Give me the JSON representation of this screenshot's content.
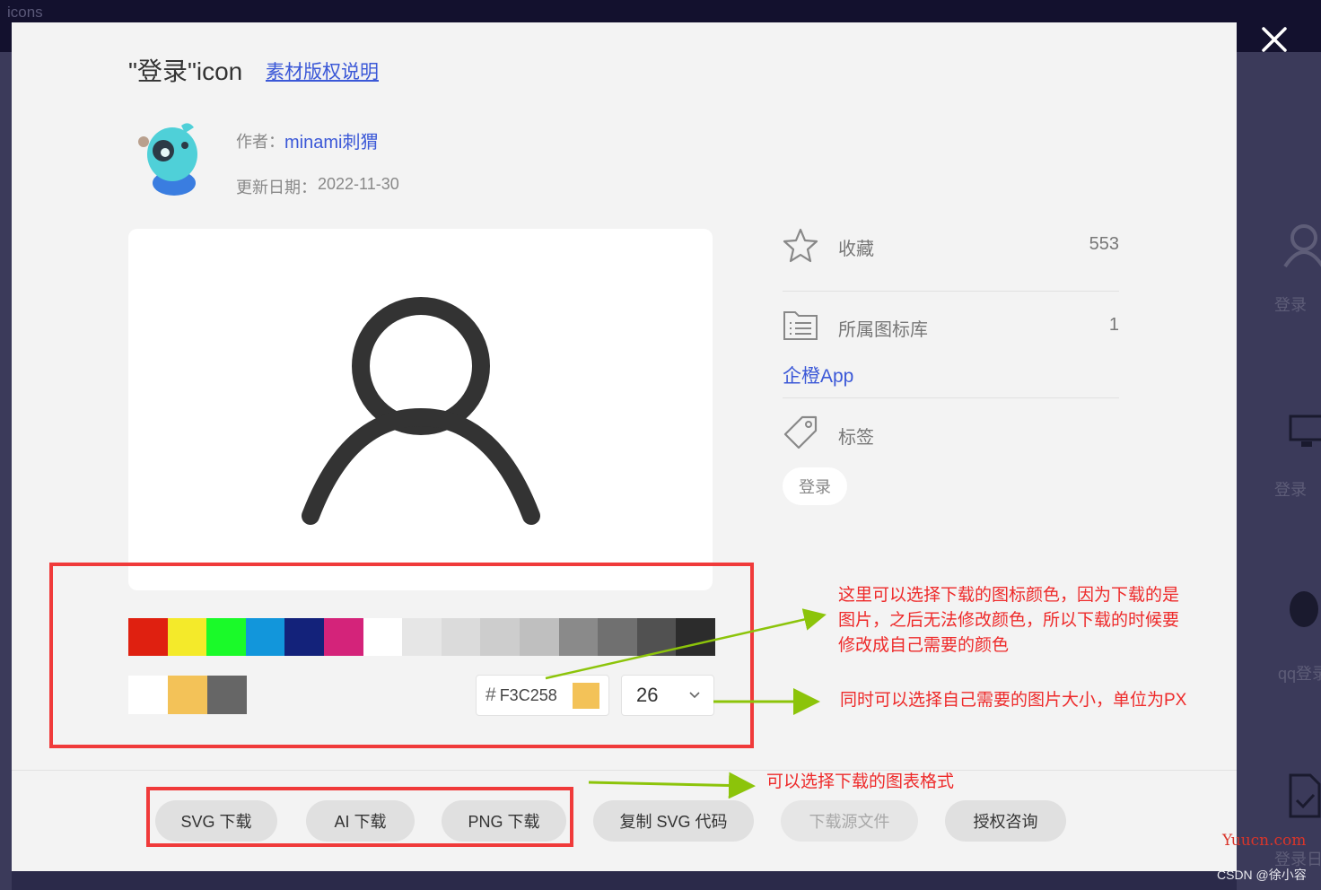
{
  "background": {
    "topbar_text": "icons",
    "side_items": [
      "登录",
      "登录",
      "qq登录",
      "登录日"
    ]
  },
  "modal": {
    "title": "\"登录\"icon",
    "copyright_link": "素材版权说明",
    "author_label": "作者：",
    "author_name": "minami刺猬",
    "date_label": "更新日期：",
    "date_value": "2022-11-30",
    "palette_row1": [
      "#df2010",
      "#f4ea2a",
      "#1afa29",
      "#1296db",
      "#13227a",
      "#d4237a",
      "#ffffff",
      "#e6e6e6",
      "#dbdbdb",
      "#cdcdcd",
      "#bfbfbf",
      "#8a8a8a",
      "#707070",
      "#515151",
      "#2c2c2c"
    ],
    "palette_row2": [
      "#ffffff",
      "#f3c258",
      "#666666"
    ],
    "hex_symbol": "#",
    "hex_value": "F3C258",
    "hex_color": "#F3C258",
    "size_value": "26",
    "stats": {
      "favorite_label": "收藏",
      "favorite_count": "553",
      "library_label": "所属图标库",
      "library_count": "1",
      "library_link": "企橙App",
      "tags_label": "标签",
      "tag": "登录"
    },
    "buttons": {
      "svg": "SVG 下载",
      "ai": "AI 下载",
      "png": "PNG 下载",
      "copy_svg": "复制 SVG 代码",
      "source": "下载源文件",
      "license": "授权咨询"
    }
  },
  "annotations": {
    "color_note": [
      "这里可以选择下载的图标颜色，因为下载的是",
      "图片，之后无法修改颜色，所以下载的时候要",
      "修改成自己需要的颜色"
    ],
    "size_note": "同时可以选择自己需要的图片大小，单位为PX",
    "format_note": "可以选择下载的图表格式"
  },
  "watermarks": {
    "site": "Yuucn.com",
    "csdn": "CSDN @徐小容"
  },
  "colors": {
    "link": "#3b58d7",
    "annotation_red": "#ee2a2a",
    "arrow_green": "#8cc40a"
  }
}
